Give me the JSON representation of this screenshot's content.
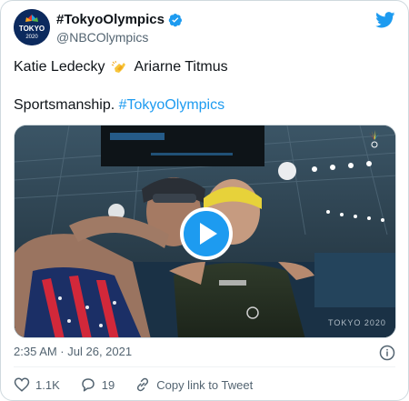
{
  "header": {
    "display_name": "#TokyoOlympics",
    "handle": "@NBCOlympics",
    "avatar_text": "TOKYO",
    "avatar_subtext": "2020",
    "verified_icon": "verified-badge-icon",
    "brand_icon": "twitter-bird-icon"
  },
  "tweet": {
    "line1_before": "Katie Ledecky",
    "line1_emoji": "clapping-hands-icon",
    "line1_after": "Ariarne Titmus",
    "line2_text": "Sportsmanship.",
    "line2_hashtag": "#TokyoOlympics"
  },
  "media": {
    "type": "video",
    "watermark": "TOKYO 2020",
    "play_icon": "play-icon"
  },
  "meta": {
    "timestamp": "2:35 AM · Jul 26, 2021"
  },
  "actions": {
    "likes": "1.1K",
    "replies": "19",
    "copy_label": "Copy link to Tweet"
  },
  "colors": {
    "accent": "#1d9bf0",
    "text": "#0f1419",
    "muted": "#536471",
    "border": "#cfd9de"
  }
}
